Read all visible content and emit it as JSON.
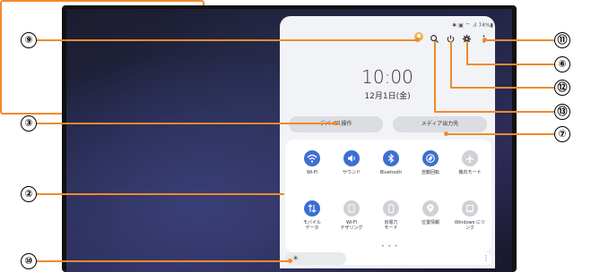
{
  "status_bar": {
    "text": "✱ ▣ ⌔ .ıl 74%▮"
  },
  "clock": {
    "time": "10:00",
    "date": "12月1日(金)"
  },
  "buttons": {
    "devices": "デバイス操作",
    "media": "メディア出力先"
  },
  "tiles": [
    {
      "label": "Wi-Fi",
      "icon": "wifi-icon",
      "state": "on"
    },
    {
      "label": "サウンド",
      "icon": "sound-icon",
      "state": "on"
    },
    {
      "label": "Bluetooth",
      "icon": "bluetooth-icon",
      "state": "on"
    },
    {
      "label": "自動回転",
      "icon": "auto-rotate-icon",
      "state": "on"
    },
    {
      "label": "機内モード",
      "icon": "airplane-icon",
      "state": "off"
    },
    {
      "label": "モバイル\nデータ",
      "icon": "mobile-data-icon",
      "state": "on"
    },
    {
      "label": "Wi-Fi\nテザリング",
      "icon": "hotspot-icon",
      "state": "off"
    },
    {
      "label": "省電力\nモード",
      "icon": "power-saving-icon",
      "state": "off"
    },
    {
      "label": "位置情報",
      "icon": "location-icon",
      "state": "off"
    },
    {
      "label": "Windows にリ\nンク",
      "icon": "link-windows-icon",
      "state": "off"
    }
  ],
  "page_indicator": "• • •",
  "brightness": {
    "sun_glyph": "☀",
    "more_glyph": "⋮"
  },
  "callouts": {
    "c2": "②",
    "c3": "③",
    "c6": "⑥",
    "c7": "⑦",
    "c9": "⑨",
    "c10": "⑩",
    "c11": "⑪",
    "c12": "⑫",
    "c13": "⑬"
  },
  "colors": {
    "accent_on": "#3e6fd0",
    "callout_line": "#f08a2c"
  }
}
